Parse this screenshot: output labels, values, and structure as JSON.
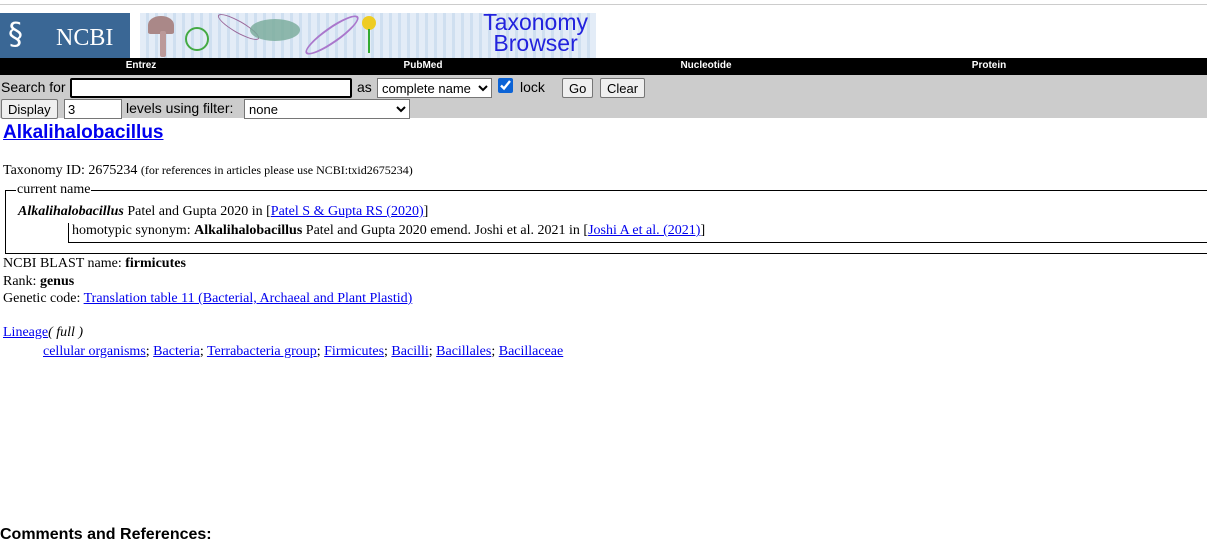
{
  "header": {
    "logo_text": "NCBI",
    "banner_title_line1": "Taxonomy",
    "banner_title_line2": "Browser"
  },
  "nav": [
    "Entrez",
    "PubMed",
    "Nucleotide",
    "Protein"
  ],
  "search": {
    "label": "Search for",
    "value": "",
    "as_label": "as",
    "as_option": "complete name",
    "lock_label": "lock",
    "lock_checked": true,
    "go": "Go",
    "clear": "Clear"
  },
  "display": {
    "button": "Display",
    "levels": "3",
    "levels_label": "levels using filter:",
    "filter": "none"
  },
  "taxon": {
    "name": "Alkalihalobacillus",
    "id_label": "Taxonomy ID:",
    "id": "2675234",
    "id_note": "(for references in articles please use NCBI:txid2675234)",
    "current_name_legend": "current name",
    "current_name": "Alkalihalobacillus",
    "current_authority": " Patel and Gupta 2020 in [",
    "current_ref": "Patel S & Gupta RS (2020)",
    "close": "]",
    "synonym_label": "homotypic synonym: ",
    "synonym_name": "Alkalihalobacillus",
    "synonym_authority": " Patel and Gupta 2020 emend. Joshi et al. 2021 in [",
    "synonym_ref": "Joshi A et al. (2021)",
    "blast_label": "NCBI BLAST name: ",
    "blast": "firmicutes",
    "rank_label": "Rank: ",
    "rank": "genus",
    "gc_label": "Genetic code: ",
    "gc": "Translation table 11 (Bacterial, Archaeal and Plant Plastid)",
    "lineage_label": "Lineage",
    "lineage_full": "( full )",
    "lineage": [
      "cellular organisms",
      "Bacteria",
      "Terrabacteria group",
      "Firmicutes",
      "Bacilli",
      "Bacillales",
      "Bacillaceae"
    ]
  },
  "comments_heading": "Comments and References:"
}
